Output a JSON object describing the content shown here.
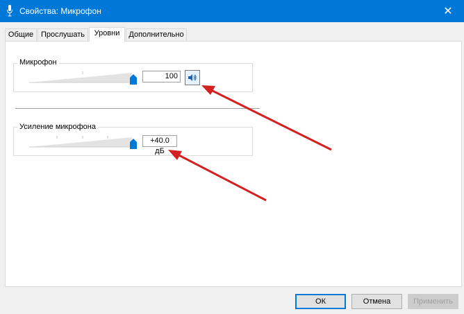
{
  "window": {
    "title": "Свойства: Микрофон",
    "close_glyph": "✕"
  },
  "tabs": [
    {
      "label": "Общие",
      "active": false
    },
    {
      "label": "Прослушать",
      "active": false
    },
    {
      "label": "Уровни",
      "active": true
    },
    {
      "label": "Дополнительно",
      "active": false
    }
  ],
  "microphone": {
    "label": "Микрофон",
    "value": "100",
    "slider_level": 1.0,
    "mute_icon": "speaker-icon"
  },
  "boost": {
    "label": "Усиление микрофона",
    "value": "+40.0 дБ",
    "slider_level": 1.0
  },
  "buttons": {
    "ok": "ОК",
    "cancel": "Отмена",
    "apply": "Применить"
  },
  "colors": {
    "titlebar": "#0078d7",
    "slider_thumb": "#0078d7",
    "annotation_arrow": "#d42020"
  }
}
